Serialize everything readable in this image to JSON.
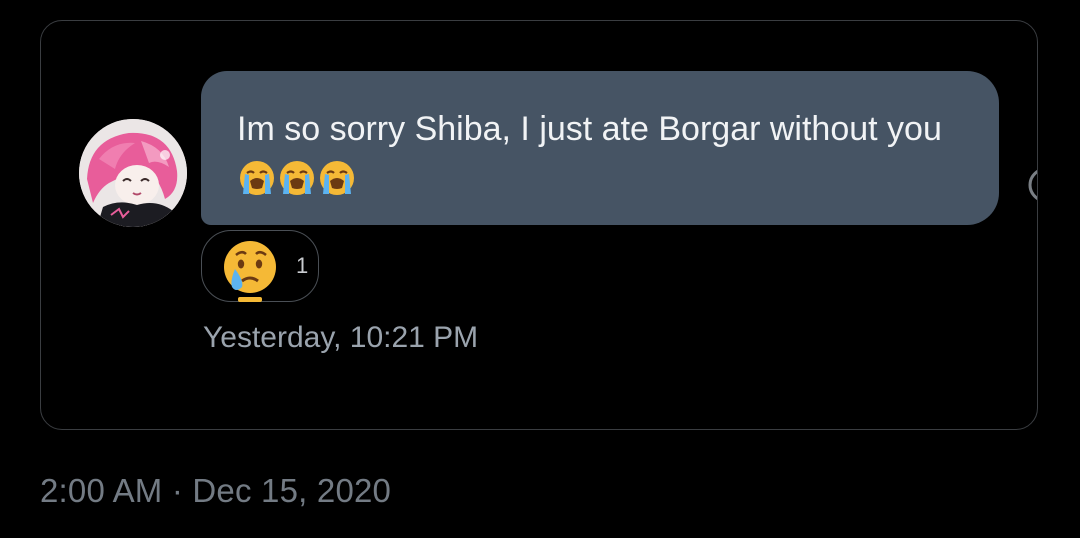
{
  "message": {
    "text": "Im so sorry Shiba, I just ate Borgar without you",
    "emojis": [
      "loudly-crying-face",
      "loudly-crying-face",
      "loudly-crying-face"
    ],
    "bubble_color": "#465464",
    "timestamp": "Yesterday, 10:21 PM"
  },
  "reaction": {
    "emoji": "sad-but-relieved-face",
    "count": "1"
  },
  "post": {
    "timestamp": "2:00 AM · Dec 15, 2020"
  },
  "colors": {
    "background": "#000000",
    "card_border": "#3a3d41",
    "secondary_text": "#9aa3ad",
    "muted_text": "#737b84"
  }
}
